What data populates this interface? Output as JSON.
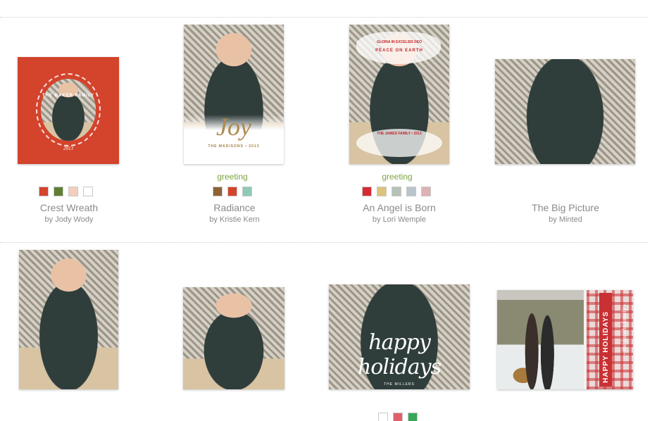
{
  "products": [
    {
      "name": "Crest Wreath",
      "designer": "by Jody Wody",
      "category": "",
      "swatches": [
        "#d4432c",
        "#5f7f35",
        "#f3cfbb",
        "#ffffff"
      ],
      "card_text": {
        "title": "THE BAKER FAMILY",
        "year": "2013"
      }
    },
    {
      "name": "Radiance",
      "designer": "by Kristie Kern",
      "category": "greeting",
      "swatches": [
        "#8c6236",
        "#d4432c",
        "#8fcab5"
      ],
      "card_text": {
        "word": "Joy",
        "sub": "THE MADISONS • 2013"
      }
    },
    {
      "name": "An Angel is Born",
      "designer": "by Lori Wemple",
      "category": "greeting",
      "swatches": [
        "#d62b34",
        "#dcc27b",
        "#b6c1b8",
        "#b9c4cc",
        "#ddb3b5"
      ],
      "card_text": {
        "top": "GLORIA IN EXCELSIS DEO",
        "sub": "PEACE ON EARTH",
        "foot": "THE JAMES FAMILY • 2013"
      }
    },
    {
      "name": "The Big Picture",
      "designer": "by Minted",
      "category": "",
      "swatches": []
    },
    {
      "name": "",
      "designer": "",
      "category": "",
      "swatches": []
    },
    {
      "name": "",
      "designer": "",
      "category": "",
      "swatches": []
    },
    {
      "name": "",
      "designer": "",
      "category": "",
      "swatches": [
        "#ffffff",
        "#e0606c",
        "#3aa65a"
      ],
      "card_text": {
        "word": "happy holidays",
        "sub": "THE MILLERS"
      }
    },
    {
      "name": "",
      "designer": "",
      "category": "",
      "swatches": [],
      "card_text": {
        "word": "HAPPY HOLIDAYS",
        "sub": "- the jacobs family -"
      }
    }
  ]
}
